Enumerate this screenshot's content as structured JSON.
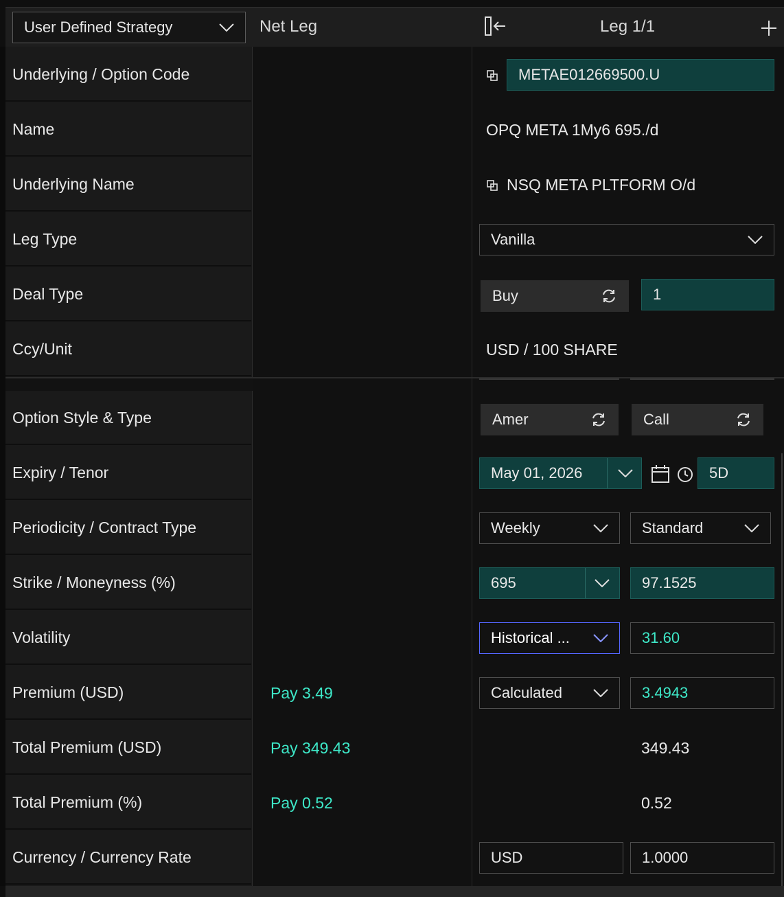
{
  "header": {
    "strategy_select": "User Defined Strategy",
    "net_leg_title": "Net Leg",
    "leg_title": "Leg 1/1"
  },
  "labels": [
    "Underlying / Option Code",
    "Name",
    "Underlying Name",
    "Leg Type",
    "Deal Type",
    "Ccy/Unit",
    "Option Style & Type",
    "Expiry / Tenor",
    "Periodicity / Contract Type",
    "Strike / Moneyness (%)",
    "Volatility",
    "Premium  (USD)",
    "Total Premium  (USD)",
    "Total Premium (%)",
    "Currency / Currency Rate"
  ],
  "net_leg": {
    "premium": "Pay 3.49",
    "total_premium_usd": "Pay 349.43",
    "total_premium_pct": "Pay 0.52"
  },
  "leg": {
    "option_code": "METAE012669500.U",
    "name": "OPQ META 1My6 695./d",
    "underlying_name": "NSQ  META PLTFORM O/d",
    "leg_type": "Vanilla",
    "deal_side": "Buy",
    "quantity": "1",
    "ccy_unit": "USD  /  100  SHARE",
    "option_style": "Amer",
    "option_type": "Call",
    "expiry": "May 01, 2026",
    "tenor": "5D",
    "periodicity": "Weekly",
    "contract_type": "Standard",
    "strike": "695",
    "moneyness": "97.1525",
    "vol_source": "Historical ...",
    "volatility": "31.60",
    "premium_mode": "Calculated",
    "premium": "3.4943",
    "total_premium_usd": "349.43",
    "total_premium_pct": "0.52",
    "currency": "USD",
    "currency_rate": "1.0000"
  },
  "colors": {
    "accent_teal": "#3ee8c8",
    "field_teal_bg": "#0f3f3d",
    "focus_border": "#5566ff"
  }
}
